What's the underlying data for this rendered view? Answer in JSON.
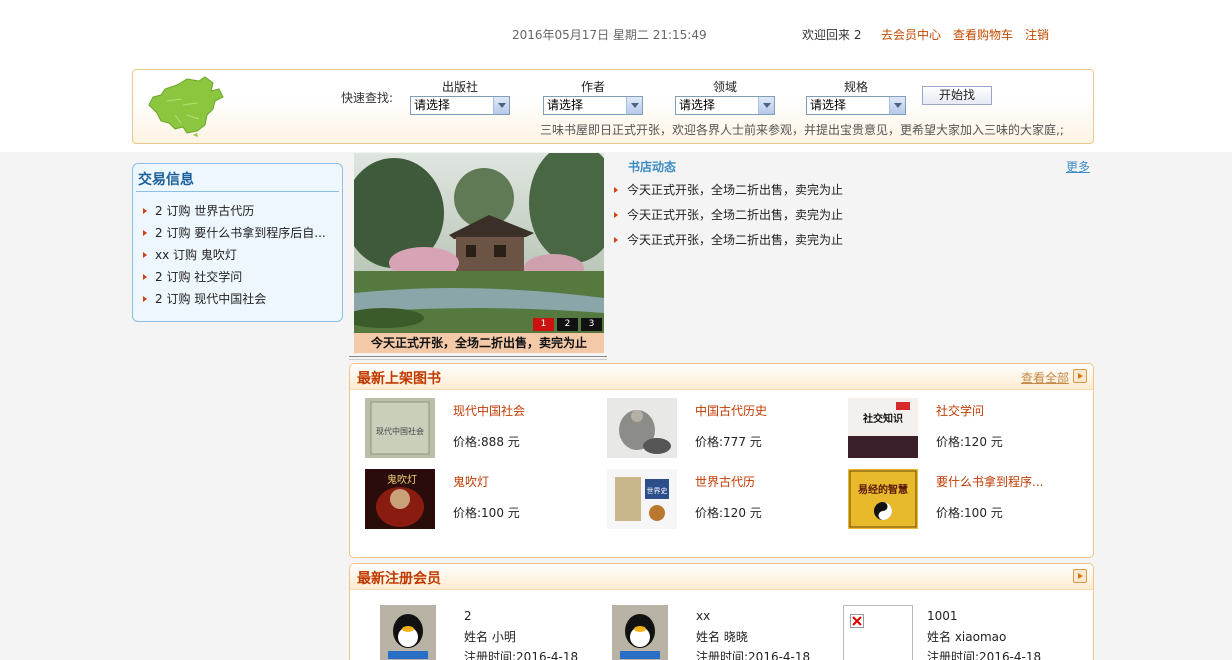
{
  "header": {
    "datetime": "2016年05月17日 星期二 21:15:49",
    "welcome": "欢迎回来 2",
    "links": [
      "去会员中心",
      "查看购物车",
      "注销"
    ]
  },
  "search": {
    "quick_label": "快速查找:",
    "filters": [
      {
        "label": "出版社",
        "value": "请选择"
      },
      {
        "label": "作者",
        "value": "请选择"
      },
      {
        "label": "领域",
        "value": "请选择"
      },
      {
        "label": "规格",
        "value": "请选择"
      }
    ],
    "button": "开始找",
    "marquee": "三味书屋即日正式开张，欢迎各界人士前来参观，并提出宝贵意见，更希望大家加入三味的大家庭,;"
  },
  "trade": {
    "title": "交易信息",
    "items": [
      "2 订购 世界古代历",
      "2 订购 要什么书拿到程序后自...",
      "xx 订购 鬼吹灯",
      "2 订购 社交学问",
      "2 订购 现代中国社会"
    ]
  },
  "slider": {
    "caption": "今天正式开张，全场二折出售，卖完为止",
    "pages": [
      "1",
      "2",
      "3"
    ],
    "active": "1"
  },
  "news": {
    "title": "书店动态",
    "more": "更多",
    "items": [
      "今天正式开张，全场二折出售，卖完为止",
      "今天正式开张，全场二折出售，卖完为止",
      "今天正式开张，全场二折出售，卖完为止"
    ]
  },
  "new_books": {
    "title": "最新上架图书",
    "view_all": "查看全部",
    "books": [
      {
        "name": "现代中国社会",
        "price": "价格:888 元"
      },
      {
        "name": "中国古代历史",
        "price": "价格:777 元"
      },
      {
        "name": "社交学问",
        "price": "价格:120 元"
      },
      {
        "name": "鬼吹灯",
        "price": "价格:100 元"
      },
      {
        "name": "世界古代历",
        "price": "价格:120 元"
      },
      {
        "name": "要什么书拿到程序...",
        "price": "价格:100 元"
      }
    ]
  },
  "new_members": {
    "title": "最新注册会员",
    "members": [
      {
        "id": "2",
        "name": "姓名  小明",
        "time": "注册时间:2016-4-18"
      },
      {
        "id": "xx",
        "name": "姓名  晓晓",
        "time": "注册时间:2016-4-18"
      },
      {
        "id": "1001",
        "name": "姓名  xiaomao",
        "time": "注册时间:2016-4-18"
      }
    ]
  },
  "colors": {
    "accent": "#c03a00",
    "link_blue": "#3c8cc4",
    "box_border": "#efc583"
  }
}
